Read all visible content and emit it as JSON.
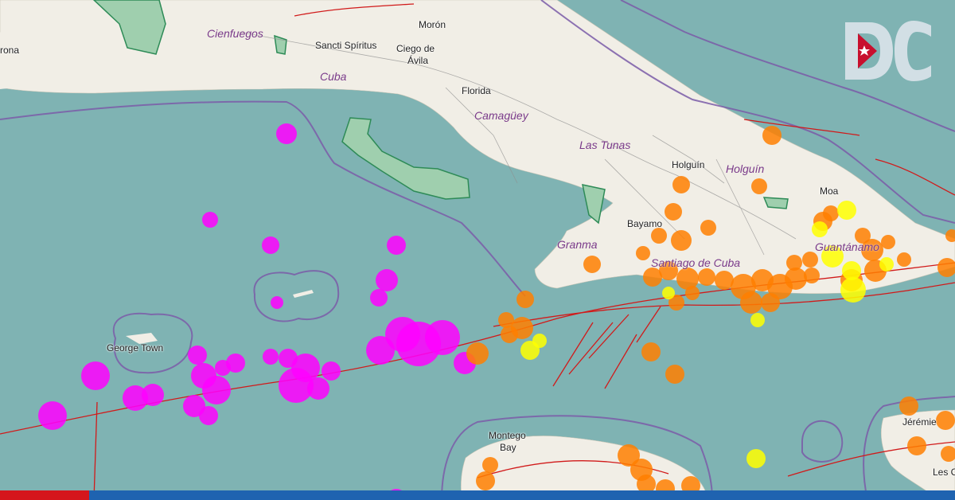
{
  "map": {
    "cities": [
      {
        "id": "moron",
        "name": "Morón"
      },
      {
        "id": "sancti",
        "name": "Sancti Spíritus"
      },
      {
        "id": "ciego1",
        "name": "Ciego de"
      },
      {
        "id": "ciego2",
        "name": "Ávila"
      },
      {
        "id": "florida",
        "name": "Florida"
      },
      {
        "id": "holguin",
        "name": "Holguín"
      },
      {
        "id": "moa",
        "name": "Moa"
      },
      {
        "id": "bayamo",
        "name": "Bayamo"
      },
      {
        "id": "george",
        "name": "George Town"
      },
      {
        "id": "montego1",
        "name": "Montego"
      },
      {
        "id": "montego2",
        "name": "Bay"
      },
      {
        "id": "jeremie",
        "name": "Jérémie"
      },
      {
        "id": "lesc",
        "name": "Les C"
      },
      {
        "id": "rona",
        "name": "rona"
      }
    ],
    "regions": [
      {
        "id": "cienfuegos",
        "name": "Cienfuegos"
      },
      {
        "id": "cuba",
        "name": "Cuba"
      },
      {
        "id": "camaguey",
        "name": "Camagüey"
      },
      {
        "id": "lastunas",
        "name": "Las Tunas"
      },
      {
        "id": "holguinprov",
        "name": "Holguín"
      },
      {
        "id": "granma",
        "name": "Granma"
      },
      {
        "id": "santiago",
        "name": "Santiago de Cuba"
      },
      {
        "id": "guantanamo",
        "name": "Guantánamo"
      }
    ],
    "colors": {
      "sea": "#7fb3b3",
      "land": "#f1eee6",
      "park": "#9fcfae",
      "border": "#7b5ca8",
      "fault": "#d11a1a",
      "magenta": "#ff00ff",
      "orange": "#ff7f00",
      "yellow": "#ffff00"
    }
  },
  "logo": {
    "letters": "DC",
    "star_icon": "star-icon",
    "colors": {
      "letter": "#dce3ea",
      "flag_red": "#c8102e"
    }
  },
  "footer": {
    "colors": {
      "red": "#d5161c",
      "blue": "#1f63b0"
    }
  }
}
